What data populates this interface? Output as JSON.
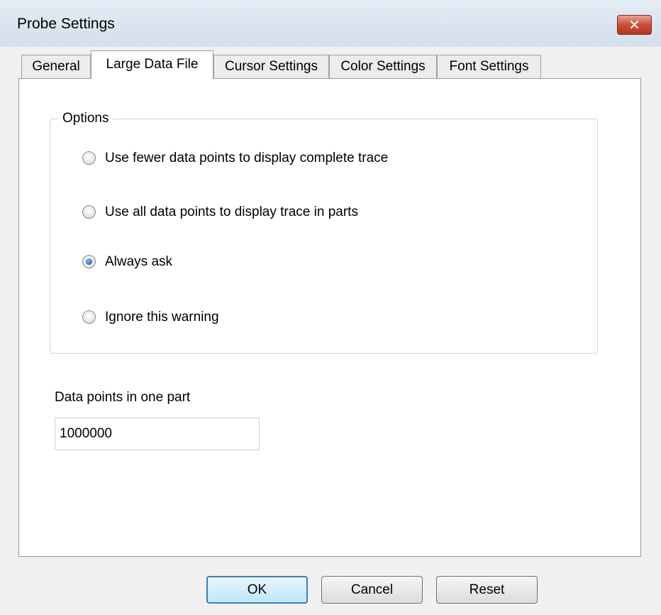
{
  "window": {
    "title": "Probe Settings",
    "close_symbol": "✕"
  },
  "tabs": [
    {
      "label": "General",
      "active": false
    },
    {
      "label": "Large Data File",
      "active": true
    },
    {
      "label": "Cursor Settings",
      "active": false
    },
    {
      "label": "Color Settings",
      "active": false
    },
    {
      "label": "Font Settings",
      "active": false
    }
  ],
  "options": {
    "legend": "Options",
    "choices": [
      {
        "label": "Use fewer data points to display complete trace",
        "checked": false
      },
      {
        "label": "Use all data points to display trace in parts",
        "checked": false
      },
      {
        "label": "Always ask",
        "checked": true
      },
      {
        "label": "Ignore this warning",
        "checked": false
      }
    ]
  },
  "data_points": {
    "label": "Data points in one part",
    "value": "1000000"
  },
  "buttons": {
    "ok": "OK",
    "cancel": "Cancel",
    "reset": "Reset"
  },
  "colors": {
    "default_button_border": "#3c7fb1",
    "close_button": "#c7503a",
    "radio_selected": "#1b4fa0"
  }
}
